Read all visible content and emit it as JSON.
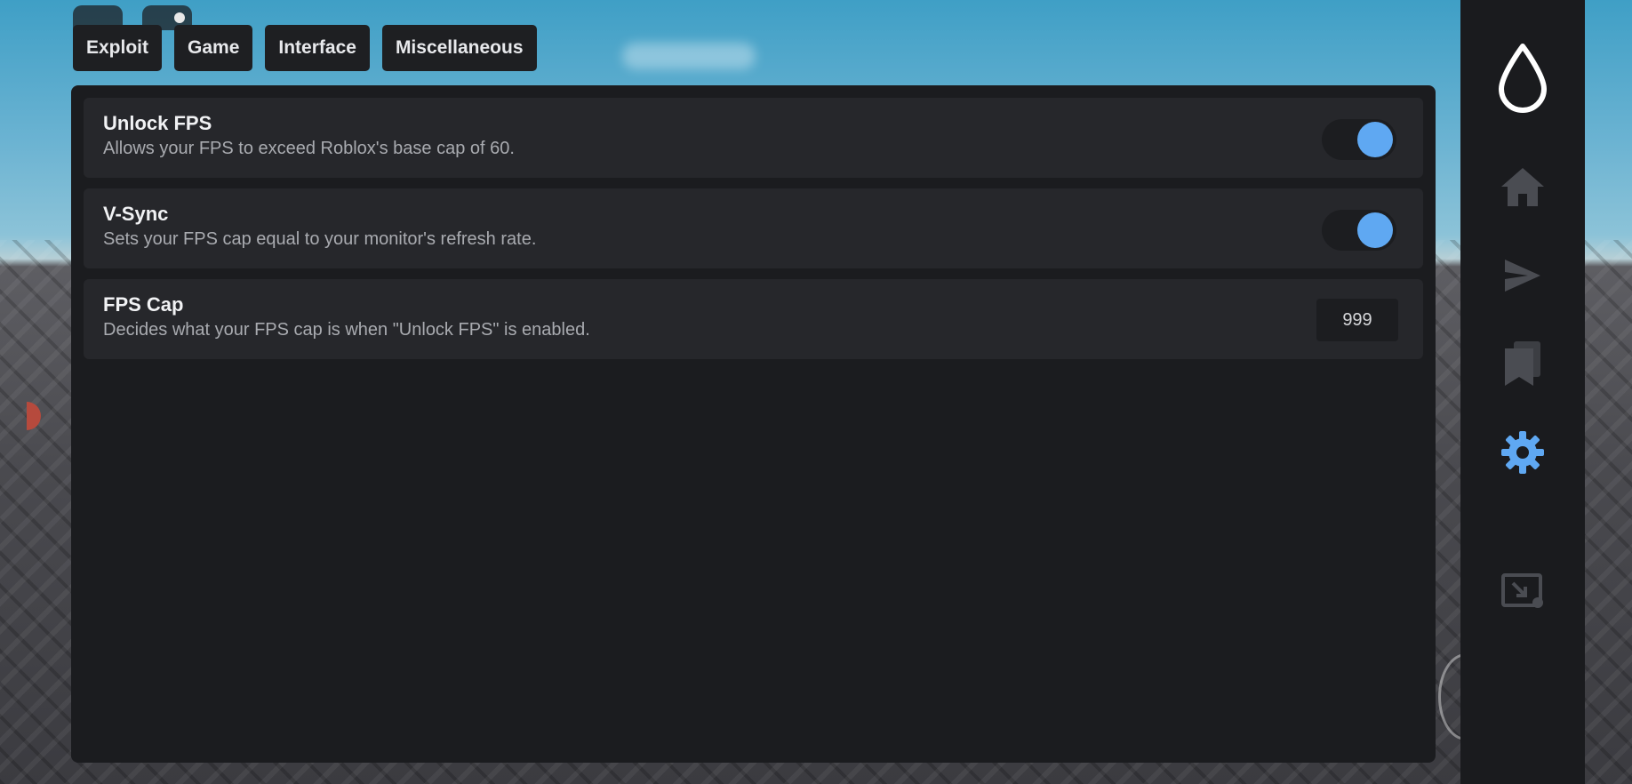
{
  "tabs": [
    {
      "label": "Exploit"
    },
    {
      "label": "Game"
    },
    {
      "label": "Interface"
    },
    {
      "label": "Miscellaneous"
    }
  ],
  "settings": [
    {
      "title": "Unlock FPS",
      "description": "Allows your FPS to exceed Roblox's base cap of 60.",
      "control": "toggle",
      "enabled": true
    },
    {
      "title": "V-Sync",
      "description": "Sets your FPS cap equal to your monitor's refresh rate.",
      "control": "toggle",
      "enabled": true
    },
    {
      "title": "FPS Cap",
      "description": "Decides what your FPS cap is when \"Unlock FPS\" is enabled.",
      "control": "number",
      "value": "999"
    }
  ],
  "sidebar": {
    "items": [
      {
        "icon": "drop-logo-icon",
        "active": false
      },
      {
        "icon": "home-icon",
        "active": false
      },
      {
        "icon": "send-icon",
        "active": false
      },
      {
        "icon": "bookmarks-icon",
        "active": false
      },
      {
        "icon": "gear-icon",
        "active": true
      },
      {
        "icon": "minimize-window-icon",
        "active": false
      }
    ]
  },
  "colors": {
    "accent": "#5fa8f2",
    "panel": "#1b1c1f",
    "card": "#26272b",
    "sidebar": "#1a1b1e",
    "icon_inactive": "#4a4c52"
  }
}
